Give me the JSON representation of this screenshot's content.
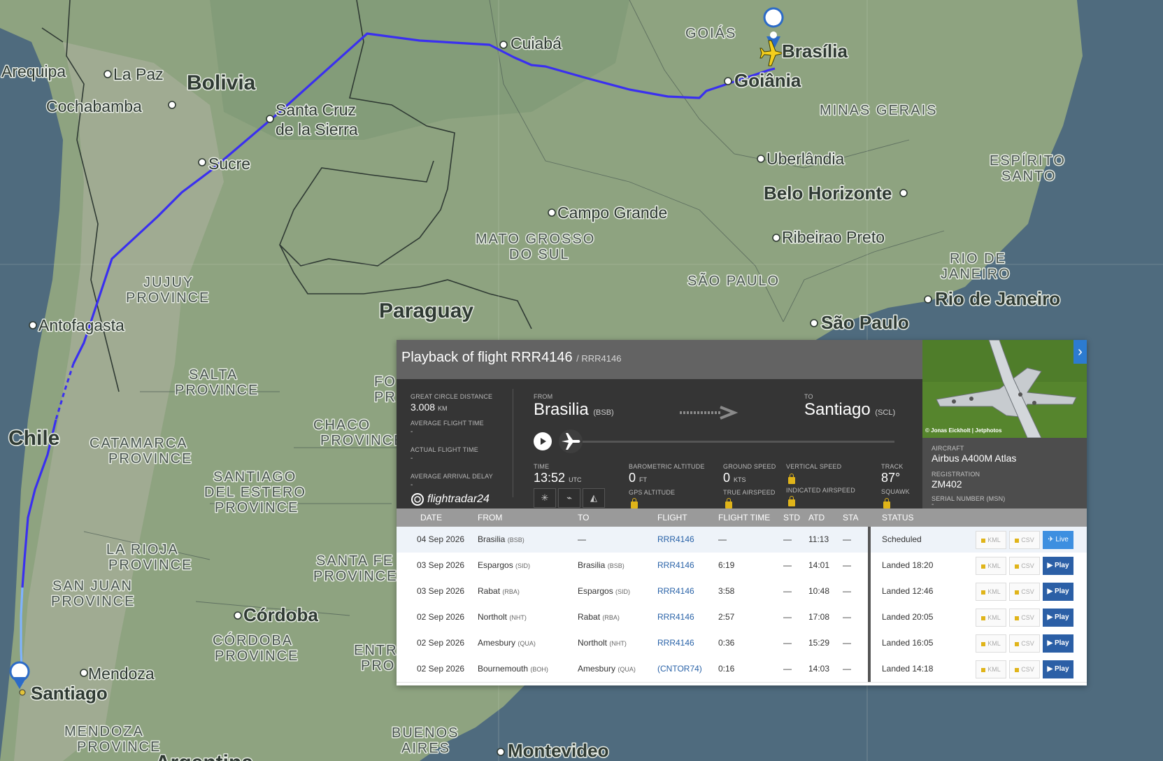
{
  "map": {
    "countries": [
      "Bolivia",
      "Paraguay",
      "Chile"
    ],
    "cities": [
      "Arequipa",
      "La Paz",
      "Cochabamba",
      "Santa Cruz",
      "de la Sierra",
      "Sucre",
      "Cuiabá",
      "Brasília",
      "Goiânia",
      "Uberlândia",
      "Belo Horizonte",
      "Campo Grande",
      "Ribeirao Preto",
      "Rio de Janeiro",
      "São Paulo",
      "Antofagasta",
      "Córdoba",
      "Mendoza",
      "Santiago",
      "Montevideo"
    ],
    "regions": [
      "GOIÁS",
      "MINAS GERAIS",
      "ESPÍRITO",
      "SANTO",
      "MATO GROSSO",
      "DO SUL",
      "SÃO PAULO",
      "RIO DE",
      "JANEIRO",
      "JUJUY",
      "PROVINCE",
      "SALTA",
      "PROVINCE",
      "CHACO",
      "PROVINCE",
      "CATAMARCA",
      "PROVINCE",
      "SANTIAGO",
      "DEL ESTERO",
      "PROVINCE",
      "LA RIOJA",
      "PROVINCE",
      "SAN JUAN",
      "PROVINCE",
      "CÓRDOBA",
      "PROVINCE",
      "SANTA FE",
      "PROVINCE",
      "ENTRE",
      "PRO",
      "FO",
      "PR",
      "MENDOZA",
      "PROVINCE",
      "BUENOS",
      "AIRES",
      "Argentina"
    ],
    "colors": {
      "track": "#3a2ff0",
      "track_end": "#7fb3ff",
      "water": "#4f6b7e",
      "land": "#8ea380"
    }
  },
  "panel": {
    "title": "Playback of flight RRR4146",
    "subtitle": "/ RRR4146",
    "gcd_label": "GREAT CIRCLE DISTANCE",
    "gcd_value": "3.008",
    "gcd_unit": "KM",
    "aft_label": "AVERAGE FLIGHT TIME",
    "aft_value": "-",
    "act_label": "ACTUAL FLIGHT TIME",
    "act_value": "-",
    "aad_label": "AVERAGE ARRIVAL DELAY",
    "aad_value": "-",
    "logo": "flightradar24",
    "from_label": "FROM",
    "from_city": "Brasilia",
    "from_code": "(BSB)",
    "to_label": "TO",
    "to_city": "Santiago",
    "to_code": "(SCL)",
    "time_label": "TIME",
    "time_value": "13:52",
    "time_unit": "UTC",
    "baro_label": "BAROMETRIC ALTITUDE",
    "baro_value": "0",
    "baro_unit": "FT",
    "gps_label": "GPS ALTITUDE",
    "gs_label": "GROUND SPEED",
    "gs_value": "0",
    "gs_unit": "KTS",
    "tas_label": "TRUE AIRSPEED",
    "vs_label": "VERTICAL SPEED",
    "ias_label": "INDICATED AIRSPEED",
    "track_label": "TRACK",
    "track_value": "87°",
    "squawk_label": "SQUAWK",
    "photo_credit": "© Jonas Eickholt | Jetphotos",
    "aircraft_label": "AIRCRAFT",
    "aircraft_value": "Airbus A400M Atlas",
    "reg_label": "REGISTRATION",
    "reg_value": "ZM402",
    "msn_label": "SERIAL NUMBER (MSN)",
    "msn_value": "-"
  },
  "table": {
    "headers": [
      "DATE",
      "FROM",
      "TO",
      "FLIGHT",
      "FLIGHT TIME",
      "STD",
      "ATD",
      "STA",
      "STATUS"
    ],
    "kml_label": "KML",
    "csv_label": "CSV",
    "rows": [
      {
        "date": "04 Sep 2026",
        "from": "Brasilia",
        "from_code": "(BSB)",
        "to": "—",
        "to_code": "",
        "flight": "RRR4146",
        "ftime": "—",
        "std": "—",
        "atd": "11:13",
        "sta": "—",
        "status": "Scheduled",
        "action": "Live"
      },
      {
        "date": "03 Sep 2026",
        "from": "Espargos",
        "from_code": "(SID)",
        "to": "Brasilia",
        "to_code": "(BSB)",
        "flight": "RRR4146",
        "ftime": "6:19",
        "std": "—",
        "atd": "14:01",
        "sta": "—",
        "status": "Landed 18:20",
        "action": "Play"
      },
      {
        "date": "03 Sep 2026",
        "from": "Rabat",
        "from_code": "(RBA)",
        "to": "Espargos",
        "to_code": "(SID)",
        "flight": "RRR4146",
        "ftime": "3:58",
        "std": "—",
        "atd": "10:48",
        "sta": "—",
        "status": "Landed 12:46",
        "action": "Play"
      },
      {
        "date": "02 Sep 2026",
        "from": "Northolt",
        "from_code": "(NHT)",
        "to": "Rabat",
        "to_code": "(RBA)",
        "flight": "RRR4146",
        "ftime": "2:57",
        "std": "—",
        "atd": "17:08",
        "sta": "—",
        "status": "Landed 20:05",
        "action": "Play"
      },
      {
        "date": "02 Sep 2026",
        "from": "Amesbury",
        "from_code": "(QUA)",
        "to": "Northolt",
        "to_code": "(NHT)",
        "flight": "RRR4146",
        "ftime": "0:36",
        "std": "—",
        "atd": "15:29",
        "sta": "—",
        "status": "Landed 16:05",
        "action": "Play"
      },
      {
        "date": "02 Sep 2026",
        "from": "Bournemouth",
        "from_code": "(BOH)",
        "to": "Amesbury",
        "to_code": "(QUA)",
        "flight": "(CNTOR74)",
        "ftime": "0:16",
        "std": "—",
        "atd": "14:03",
        "sta": "—",
        "status": "Landed 14:18",
        "action": "Play"
      }
    ]
  }
}
